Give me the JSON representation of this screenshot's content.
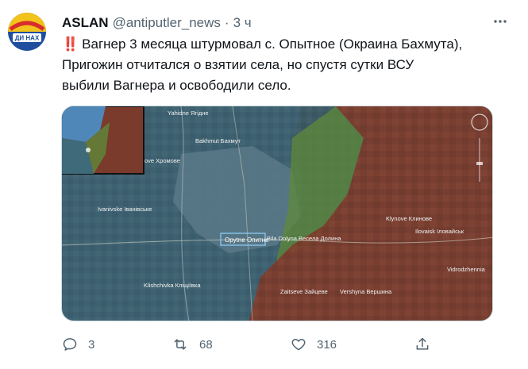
{
  "tweet": {
    "author_name": "ASLAN",
    "author_handle": "@antiputler_news",
    "separator": "·",
    "time": "3 ч",
    "avatar_caption": "ДИ НАХ",
    "text_lines": [
      "Вагнер 3 месяца штурмовал с. Опытное (Окраина Бахмута),",
      "Пригожин отчитался о взятии села, но спустя сутки ВСУ",
      "выбили Вагнера и освободили село."
    ],
    "emoji": "‼️"
  },
  "map": {
    "labels": {
      "yahidne": "Yahidne Ягідне",
      "khromove": "ove Хромове",
      "bakhmut": "Bakhmut Бахмут",
      "ivanivske": "Ivanivske Іванівське",
      "opytne": "Opytne Опитне",
      "bila_dolyna": "Bila Dolyna Весела Долина",
      "klynove": "Klynove Клинове",
      "ilovaisk": "Ilovaisk Іловайськ",
      "klishchivka": "Klishchivka Кліщіївка",
      "zaitseve": "Zaitseve Зайцеве",
      "vershyna": "Vershyna Вершина",
      "vidrodzhennia": "Vidrodzhennia"
    }
  },
  "actions": {
    "reply_count": "3",
    "retweet_count": "68",
    "like_count": "316"
  },
  "colors": {
    "text_primary": "#0f1419",
    "text_secondary": "#536471",
    "occupied_red": "#8b3a2c",
    "liberated_green": "#5f8a3a",
    "ua_blue": "#4a90c8"
  }
}
